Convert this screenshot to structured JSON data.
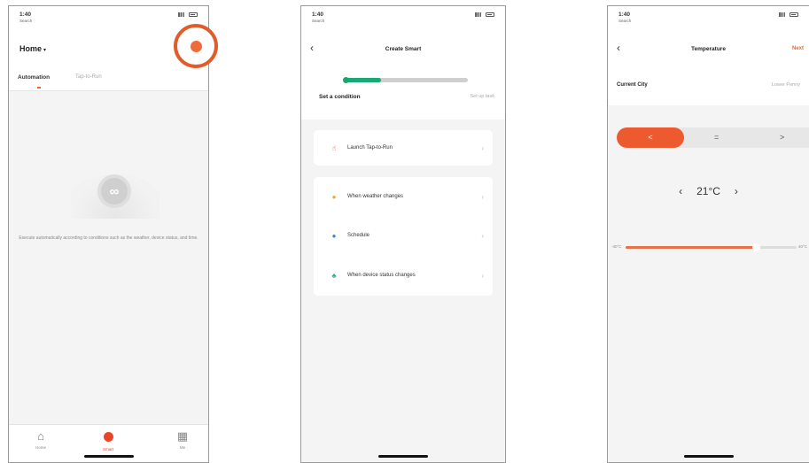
{
  "screens": [
    {
      "status": {
        "time": "1:40",
        "carrier": "Search"
      },
      "header": {
        "title": "Home",
        "caret": "▾",
        "add_button_icon": "plus-circle-icon",
        "highlight_color": "#e05c2c"
      },
      "tabs": [
        {
          "label": "Automation",
          "active": true
        },
        {
          "label": "Tap-to-Run",
          "active": false
        }
      ],
      "empty_state": {
        "icon": "infinity-icon",
        "glyph": "∞",
        "text": "Execute automatically according to conditions such as the weather, device status, and time."
      },
      "tab_bar": [
        {
          "label": "Home",
          "icon": "home-icon",
          "glyph": "⌂"
        },
        {
          "label": "Smart",
          "icon": "smart-icon",
          "glyph": ""
        },
        {
          "label": "Me",
          "icon": "me-icon",
          "glyph": "▦"
        }
      ]
    },
    {
      "status": {
        "time": "1:40",
        "carrier": "Search"
      },
      "nav": {
        "back_glyph": "‹",
        "title": "Create Smart"
      },
      "progress": {
        "fraction": 0.3,
        "step_current": "Set a condition",
        "step_next": "Set up task"
      },
      "items": [
        {
          "label": "Launch Tap-to-Run",
          "icon": "tap-icon",
          "glyph": "☝",
          "color": "#e8452a"
        },
        {
          "label": "When weather changes",
          "icon": "sun-icon",
          "glyph": "●",
          "color": "#f5a623"
        },
        {
          "label": "Schedule",
          "icon": "clock-icon",
          "glyph": "●",
          "color": "#3f7fe0"
        },
        {
          "label": "When device status changes",
          "icon": "device-icon",
          "glyph": "♣",
          "color": "#2bb57a"
        }
      ]
    },
    {
      "status": {
        "time": "1:40",
        "carrier": "Search"
      },
      "nav": {
        "back_glyph": "‹",
        "title": "Temperature",
        "action": "Next"
      },
      "city": {
        "label": "Current City",
        "value": "Lower Penny"
      },
      "segments": [
        {
          "label": "<",
          "active": true
        },
        {
          "label": "=",
          "active": false
        },
        {
          "label": ">",
          "active": false
        }
      ],
      "temperature": {
        "value": "21°C",
        "dec": "‹",
        "inc": "›"
      },
      "slider": {
        "min_label": "-40°C",
        "max_label": "40°C",
        "fraction": 0.76
      },
      "accent": "#ee5a2f"
    }
  ]
}
